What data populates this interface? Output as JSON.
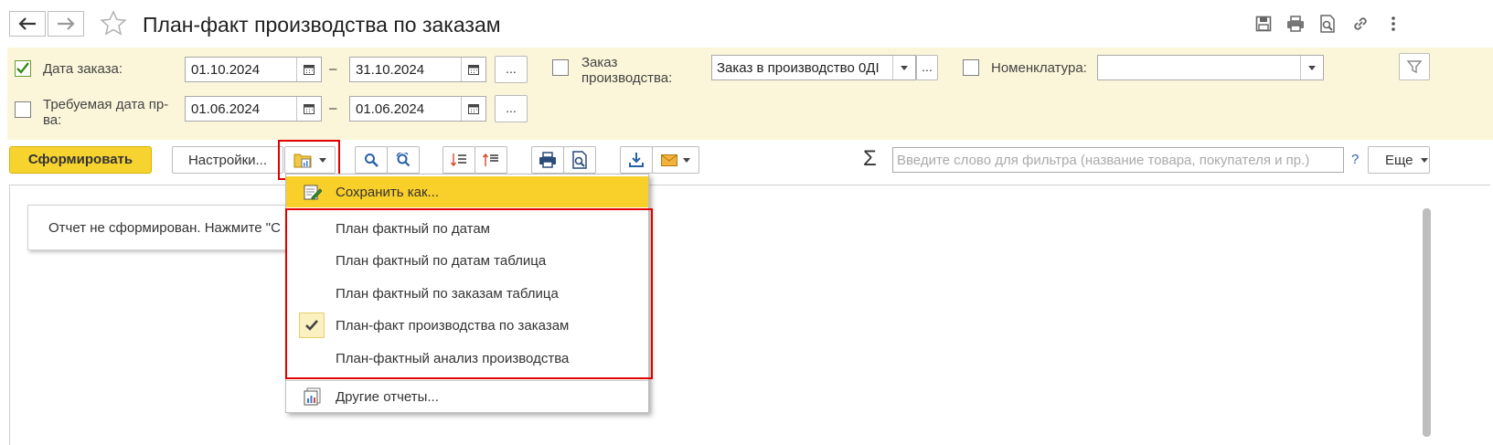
{
  "window": {
    "title": "План-факт производства по заказам"
  },
  "filters": {
    "order_date": {
      "label": "Дата заказа:",
      "checked": true,
      "from": "01.10.2024",
      "to": "31.10.2024"
    },
    "required_date": {
      "label": "Требуемая дата пр-ва:",
      "checked": false,
      "from": "01.06.2024",
      "to": "01.06.2024"
    },
    "range_dash": "–",
    "dots": "...",
    "production_order": {
      "label": "Заказ производства:",
      "checked": false,
      "value": "Заказ в производство 0ДI"
    },
    "nomenclature": {
      "label": "Номенклатура:",
      "checked": false,
      "value": ""
    }
  },
  "toolbar": {
    "generate": "Сформировать",
    "settings": "Настройки...",
    "search_placeholder": "Введите слово для фильтра (название товара, покупателя и пр.)",
    "help": "?",
    "more": "Еще",
    "sigma": "Σ"
  },
  "content": {
    "notice": "Отчет не сформирован. Нажмите \"С"
  },
  "menu": {
    "save_as": "Сохранить как...",
    "variants": [
      "План фактный по датам",
      "План фактный по датам таблица",
      "План фактный по заказам таблица",
      "План-факт производства по заказам",
      "План-фактный анализ производства"
    ],
    "selected_index": 3,
    "other_reports": "Другие отчеты..."
  },
  "colors": {
    "accent": "#f7d330",
    "filter_bg": "#fbf6d9",
    "highlight_red": "#e00000",
    "menu_hover": "#f9cf2a"
  }
}
